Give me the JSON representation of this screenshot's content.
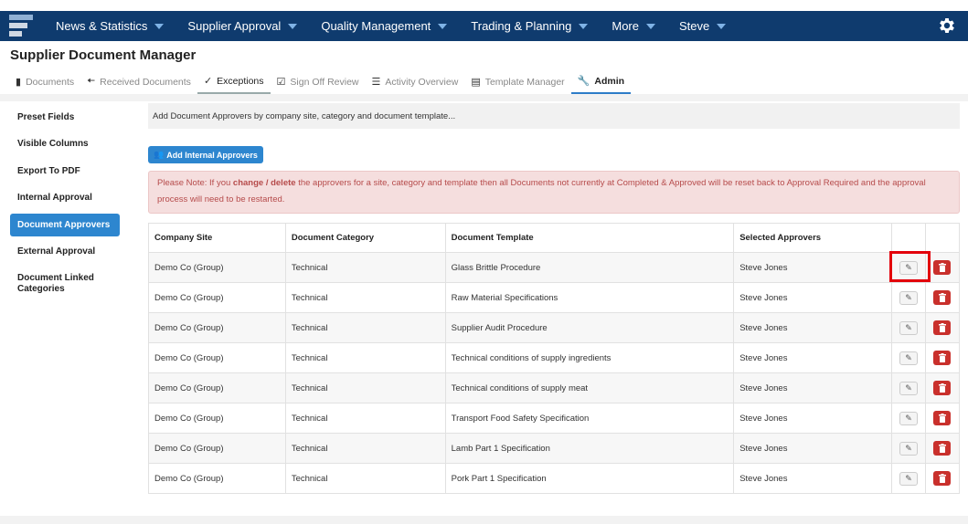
{
  "nav": {
    "items": [
      {
        "label": "News & Statistics"
      },
      {
        "label": "Supplier Approval"
      },
      {
        "label": "Quality Management"
      },
      {
        "label": "Trading & Planning"
      },
      {
        "label": "More"
      },
      {
        "label": "Steve"
      }
    ]
  },
  "page": {
    "title": "Supplier Document Manager"
  },
  "tabs": [
    {
      "label": "Documents",
      "icon": "file-icon"
    },
    {
      "label": "Received Documents",
      "icon": "arrow-left-icon"
    },
    {
      "label": "Exceptions",
      "icon": "check-circle-icon"
    },
    {
      "label": "Sign Off Review",
      "icon": "check-square-icon"
    },
    {
      "label": "Activity Overview",
      "icon": "list-icon"
    },
    {
      "label": "Template Manager",
      "icon": "document-icon"
    },
    {
      "label": "Admin",
      "icon": "wrench-icon"
    }
  ],
  "sidebar": {
    "items": [
      {
        "label": "Preset Fields"
      },
      {
        "label": "Visible Columns"
      },
      {
        "label": "Export To PDF"
      },
      {
        "label": "Internal Approval"
      },
      {
        "label": "Document Approvers"
      },
      {
        "label": "External Approval"
      },
      {
        "label": "Document Linked Categories"
      }
    ]
  },
  "main": {
    "info": "Add Document Approvers by company site, category and document template...",
    "add_button": "Add Internal Approvers",
    "note": {
      "part1": "Please Note: If you ",
      "bold": "change / delete",
      "part2": " the approvers for a site, category and template then all Documents not currently at Completed & Approved will be reset back to Approval Required and the approval process will need to be restarted."
    },
    "table": {
      "headers": [
        "Company Site",
        "Document Category",
        "Document Template",
        "Selected Approvers"
      ],
      "rows": [
        [
          "Demo Co (Group)",
          "Technical",
          "Glass Brittle Procedure",
          "Steve Jones"
        ],
        [
          "Demo Co (Group)",
          "Technical",
          "Raw Material Specifications",
          "Steve Jones"
        ],
        [
          "Demo Co (Group)",
          "Technical",
          "Supplier Audit Procedure",
          "Steve Jones"
        ],
        [
          "Demo Co (Group)",
          "Technical",
          "Technical conditions of supply ingredients",
          "Steve Jones"
        ],
        [
          "Demo Co (Group)",
          "Technical",
          "Technical conditions of supply meat",
          "Steve Jones"
        ],
        [
          "Demo Co (Group)",
          "Technical",
          "Transport Food Safety Specification",
          "Steve Jones"
        ],
        [
          "Demo Co (Group)",
          "Technical",
          "Lamb Part 1 Specification",
          "Steve Jones"
        ],
        [
          "Demo Co (Group)",
          "Technical",
          "Pork Part 1 Specification",
          "Steve Jones"
        ]
      ]
    }
  },
  "colors": {
    "nav_bg": "#0f3b6e",
    "accent": "#2d86cf",
    "danger": "#c9302c",
    "highlight": "#e3000b"
  }
}
